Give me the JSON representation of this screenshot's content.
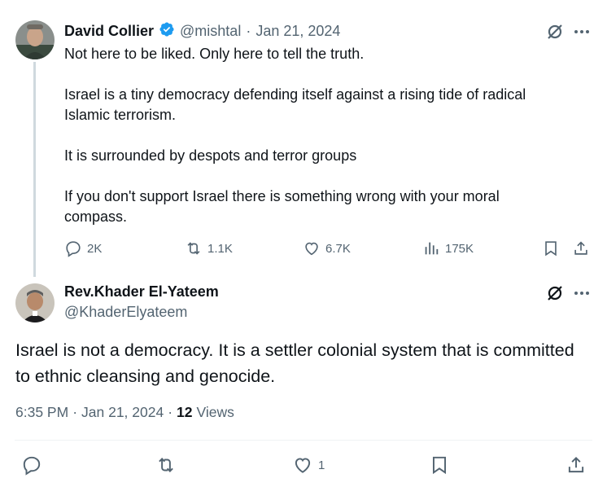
{
  "parent_tweet": {
    "author_name": "David Collier",
    "handle": "@mishtal",
    "separator": "·",
    "date": "Jan 21, 2024",
    "text": "Not here to be liked. Only here to tell the truth.\n\nIsrael is a tiny democracy defending itself against a rising tide of radical\nIslamic terrorism.\n\nIt is surrounded by despots and terror groups\n\nIf you don't support Israel there is something wrong with your moral\ncompass.",
    "replies": "2K",
    "retweets": "1.1K",
    "likes": "6.7K",
    "views": "175K"
  },
  "reply_tweet": {
    "author_name": "Rev.Khader El-Yateem",
    "handle": "@KhaderElyateem",
    "text": "Israel is not a democracy. It is a settler colonial system that is committed\nto ethnic cleansing and genocide.",
    "time": "6:35 PM",
    "separator": "·",
    "date": "Jan 21, 2024",
    "views_count": "12",
    "views_label": "Views",
    "likes": "1"
  },
  "colors": {
    "text_primary": "#0f1419",
    "text_muted": "#536471",
    "verified_blue": "#1d9bf0",
    "divider": "#eff3f4"
  },
  "icons": [
    "verified-badge-icon",
    "grok-icon",
    "more-icon",
    "reply-icon",
    "retweet-icon",
    "like-icon",
    "views-icon",
    "bookmark-icon",
    "share-icon"
  ]
}
